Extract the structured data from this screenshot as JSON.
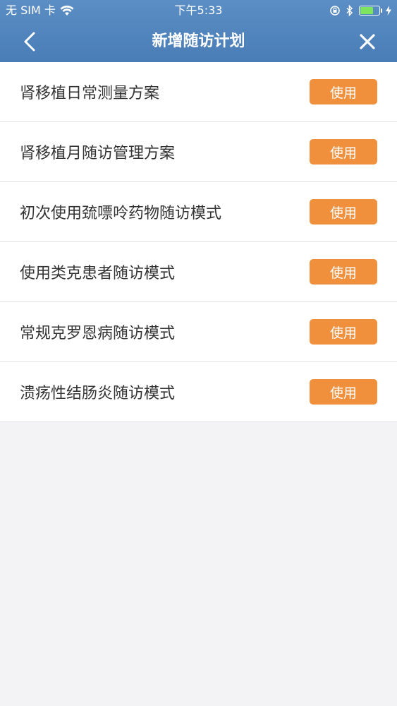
{
  "status_bar": {
    "carrier": "无 SIM 卡",
    "time": "下午5:33",
    "battery_level": 0.7,
    "icons": [
      "wifi-icon",
      "orientation-lock-icon",
      "bluetooth-icon",
      "battery-icon",
      "charging-icon"
    ]
  },
  "nav": {
    "title": "新增随访计划",
    "back_icon": "chevron-left-icon",
    "close_icon": "close-icon"
  },
  "colors": {
    "header": "#4a7db6",
    "button": "#f0903c",
    "background": "#f3f3f5"
  },
  "plans": [
    {
      "label": "肾移植日常测量方案",
      "button": "使用"
    },
    {
      "label": "肾移植月随访管理方案",
      "button": "使用"
    },
    {
      "label": "初次使用巯嘌呤药物随访模式",
      "button": "使用"
    },
    {
      "label": "使用类克患者随访模式",
      "button": "使用"
    },
    {
      "label": "常规克罗恩病随访模式",
      "button": "使用"
    },
    {
      "label": "溃疡性结肠炎随访模式",
      "button": "使用"
    }
  ]
}
